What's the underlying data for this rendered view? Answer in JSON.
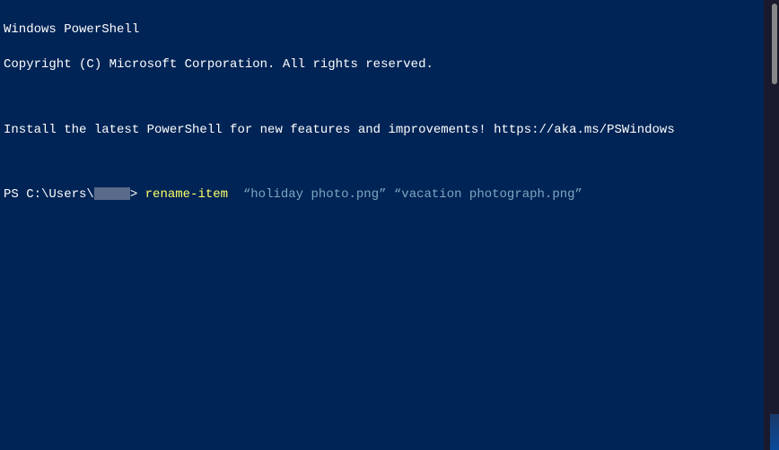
{
  "terminal": {
    "header": "Windows PowerShell",
    "copyright": "Copyright (C) Microsoft Corporation. All rights reserved.",
    "install_msg": "Install the latest PowerShell for new features and improvements! https://aka.ms/PSWindows",
    "prompt": {
      "prefix": "PS C:\\Users\\",
      "redacted_user": "████",
      "suffix": "> ",
      "cmdlet": "rename-item",
      "spacer": "  ",
      "args": "“holiday photo.png” “vacation photograph.png”"
    }
  }
}
